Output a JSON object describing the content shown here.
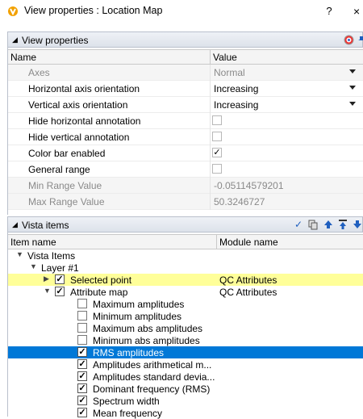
{
  "window": {
    "title": "View properties : Location Map",
    "help": "?",
    "close": "×"
  },
  "view_panel": {
    "title": "View properties",
    "columns": [
      "Name",
      "Value"
    ],
    "rows": [
      {
        "label": "Axes",
        "value": "Normal",
        "kind": "dropdown",
        "disabled": true
      },
      {
        "label": "Horizontal axis orientation",
        "value": "Increasing",
        "kind": "dropdown",
        "disabled": false
      },
      {
        "label": "Vertical axis orientation",
        "value": "Increasing",
        "kind": "dropdown",
        "disabled": false
      },
      {
        "label": "Hide horizontal annotation",
        "value": "",
        "kind": "checkbox",
        "checked": false
      },
      {
        "label": "Hide vertical annotation",
        "value": "",
        "kind": "checkbox",
        "checked": false
      },
      {
        "label": "Color bar enabled",
        "value": "",
        "kind": "checkbox",
        "checked": true
      },
      {
        "label": "General range",
        "value": "",
        "kind": "checkbox",
        "checked": false
      },
      {
        "label": "Min Range Value",
        "value": "-0.05114579201",
        "kind": "text",
        "disabled": true
      },
      {
        "label": "Max Range Value",
        "value": "50.3246727",
        "kind": "text",
        "disabled": true
      }
    ]
  },
  "vista_panel": {
    "title": "Vista items",
    "columns": [
      "Item name",
      "Module name"
    ],
    "tree": [
      {
        "label": "Vista Items",
        "module": "",
        "level": 0,
        "expander": "▼",
        "checkbox": "none",
        "highlight": ""
      },
      {
        "label": "Layer  #1",
        "module": "",
        "level": 1,
        "expander": "▼",
        "checkbox": "none",
        "highlight": ""
      },
      {
        "label": "Selected point",
        "module": "QC Attributes",
        "level": 2,
        "expander": "▶",
        "checkbox": "checked",
        "highlight": "yellow"
      },
      {
        "label": "Attribute map",
        "module": "QC Attributes",
        "level": 2,
        "expander": "▼",
        "checkbox": "checked",
        "highlight": ""
      },
      {
        "label": "Maximum amplitudes",
        "module": "",
        "level": 3,
        "expander": "",
        "checkbox": "unchecked",
        "highlight": ""
      },
      {
        "label": "Minimum amplitudes",
        "module": "",
        "level": 3,
        "expander": "",
        "checkbox": "unchecked",
        "highlight": ""
      },
      {
        "label": "Maximum abs amplitudes",
        "module": "",
        "level": 3,
        "expander": "",
        "checkbox": "unchecked",
        "highlight": ""
      },
      {
        "label": "Minimum abs amplitudes",
        "module": "",
        "level": 3,
        "expander": "",
        "checkbox": "unchecked",
        "highlight": ""
      },
      {
        "label": "RMS amplitudes",
        "module": "",
        "level": 3,
        "expander": "",
        "checkbox": "checked",
        "highlight": "blue"
      },
      {
        "label": "Amplitudes arithmetical m...",
        "module": "",
        "level": 3,
        "expander": "",
        "checkbox": "checked",
        "highlight": ""
      },
      {
        "label": "Amplitudes standard devia...",
        "module": "",
        "level": 3,
        "expander": "",
        "checkbox": "checked",
        "highlight": ""
      },
      {
        "label": "Dominant frequency (RMS)",
        "module": "",
        "level": 3,
        "expander": "",
        "checkbox": "checked",
        "highlight": ""
      },
      {
        "label": "Spectrum width",
        "module": "",
        "level": 3,
        "expander": "",
        "checkbox": "checked",
        "highlight": ""
      },
      {
        "label": "Mean frequency",
        "module": "",
        "level": 3,
        "expander": "",
        "checkbox": "checked",
        "highlight": ""
      }
    ]
  },
  "colors": {
    "selected_blue": "#0078d7",
    "highlight_yellow": "#ffff99",
    "header_bg": "#dde2ea"
  }
}
